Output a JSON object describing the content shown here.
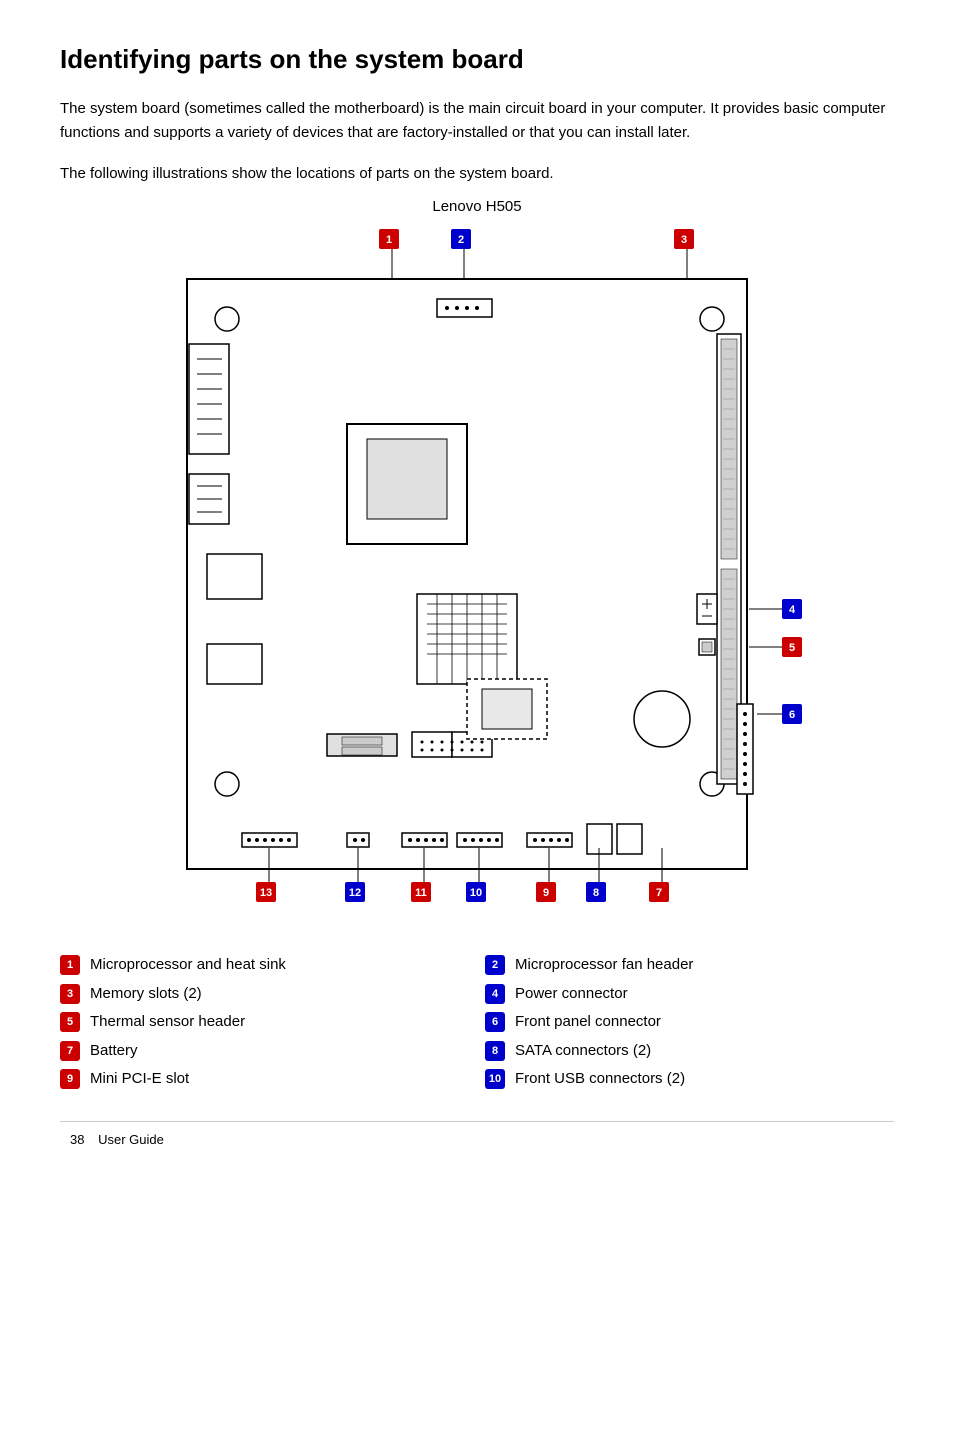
{
  "page": {
    "title": "Identifying parts on the system board",
    "intro": "The system board (sometimes called the motherboard) is the main circuit board in your computer. It provides basic computer functions and supports a variety of devices that are factory-installed or that you can install later.",
    "caption": "The following illustrations show the locations of parts on the system board.",
    "diagram_title": "Lenovo H505",
    "parts": [
      {
        "num": "1",
        "label": "Microprocessor and heat sink",
        "color": "red"
      },
      {
        "num": "2",
        "label": "Microprocessor fan header",
        "color": "blue"
      },
      {
        "num": "3",
        "label": "Memory slots (2)",
        "color": "red"
      },
      {
        "num": "4",
        "label": "Power connector",
        "color": "blue"
      },
      {
        "num": "5",
        "label": "Thermal sensor header",
        "color": "red"
      },
      {
        "num": "6",
        "label": "Front panel connector",
        "color": "blue"
      },
      {
        "num": "7",
        "label": "Battery",
        "color": "red"
      },
      {
        "num": "8",
        "label": "SATA connectors (2)",
        "color": "blue"
      },
      {
        "num": "9",
        "label": "Mini PCI-E slot",
        "color": "red"
      },
      {
        "num": "10",
        "label": "Front USB connectors (2)",
        "color": "blue"
      }
    ],
    "footer": {
      "page_num": "38",
      "label": "User Guide"
    }
  }
}
